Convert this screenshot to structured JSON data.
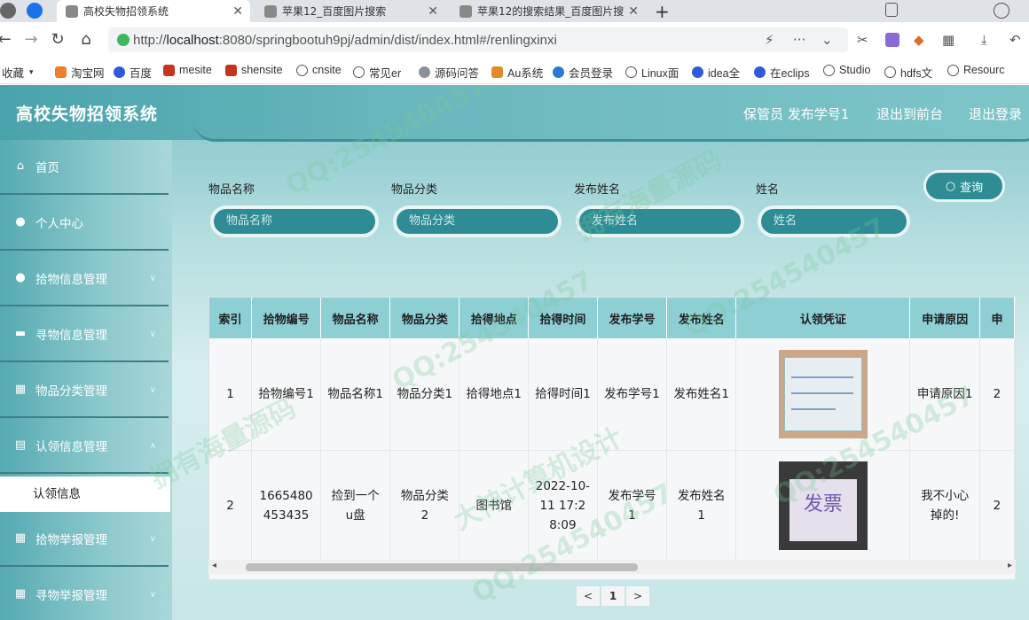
{
  "browser": {
    "tabs": [
      {
        "title": "高校失物招领系统",
        "active": true
      },
      {
        "title": "苹果12_百度图片搜索",
        "active": false
      },
      {
        "title": "苹果12的搜索结果_百度图片搜",
        "active": false
      }
    ],
    "new_tab": "+",
    "url_prefix": "http://",
    "url_host": "localhost",
    "url_rest": ":8080/springbootuh9pj/admin/dist/index.html#/renlingxinxi",
    "bookmarks": [
      "收藏",
      "淘宝网",
      "百度",
      "mesite",
      "shensite",
      "cnsite",
      "常见er",
      "源码问答",
      "Au系统",
      "会员登录",
      "Linux面",
      "idea全",
      "在eclips",
      "Studio",
      "hdfs文",
      "Resourc"
    ]
  },
  "app": {
    "title": "高校失物招领系统",
    "user_label": "保管员 发布学号1",
    "front_link": "退出到前台",
    "logout_link": "退出登录"
  },
  "sidebar": {
    "items": [
      {
        "label": "首页",
        "icon": "home-icon"
      },
      {
        "label": "个人中心",
        "icon": "user-icon"
      },
      {
        "label": "拾物信息管理",
        "icon": "bulb-icon"
      },
      {
        "label": "寻物信息管理",
        "icon": "briefcase-icon"
      },
      {
        "label": "物品分类管理",
        "icon": "grid-icon"
      },
      {
        "label": "认领信息管理",
        "icon": "monitor-icon"
      },
      {
        "label": "拾物举报管理",
        "icon": "grid-icon"
      },
      {
        "label": "寻物举报管理",
        "icon": "grid-icon"
      }
    ],
    "active_sub": "认领信息"
  },
  "search": {
    "fields": [
      {
        "label": "物品名称",
        "placeholder": "物品名称"
      },
      {
        "label": "物品分类",
        "placeholder": "物品分类"
      },
      {
        "label": "发布姓名",
        "placeholder": "发布姓名"
      },
      {
        "label": "姓名",
        "placeholder": "姓名"
      }
    ],
    "button": "查询"
  },
  "table": {
    "headers": [
      "索引",
      "拾物编号",
      "物品名称",
      "物品分类",
      "拾得地点",
      "拾得时间",
      "发布学号",
      "发布姓名",
      "认领凭证",
      "申请原因",
      "申"
    ],
    "rows": [
      {
        "index": "1",
        "code": "拾物编号1",
        "name": "物品名称1",
        "category": "物品分类1",
        "place": "拾得地点1",
        "time": "拾得时间1",
        "pub_no": "发布学号1",
        "pub_name": "发布姓名1",
        "proof": "",
        "reason": "申请原因1",
        "extra": "2"
      },
      {
        "index": "2",
        "code": "1665480453435",
        "name": "捡到一个u盘",
        "category": "物品分类2",
        "place": "图书馆",
        "time": "2022-10-11 17:28:09",
        "pub_no": "发布学号1",
        "pub_name": "发布姓名1",
        "proof": "发票",
        "reason": "我不小心掉的!",
        "extra": "2"
      }
    ]
  },
  "pager": {
    "prev": "<",
    "page": "1",
    "next": ">"
  },
  "watermarks": [
    "QQ:254540457",
    "拥有海量源码",
    "大神计算机设计"
  ]
}
